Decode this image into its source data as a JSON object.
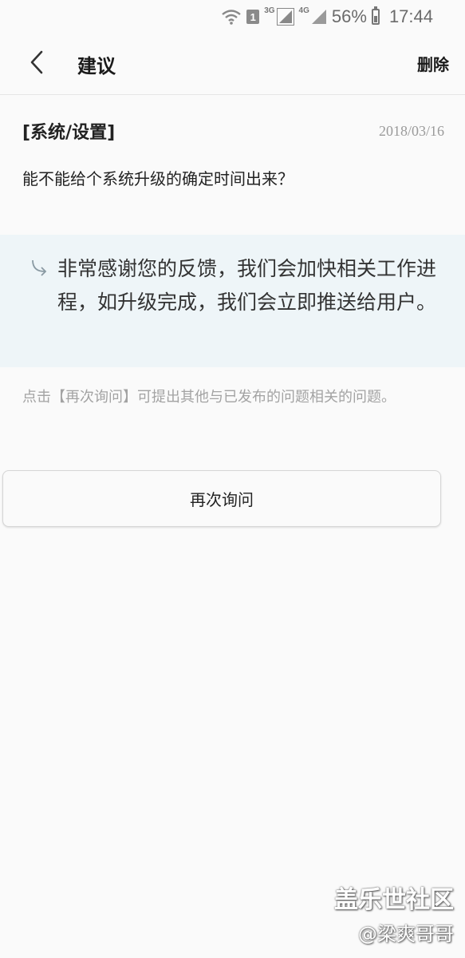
{
  "status_bar": {
    "sim_slot": "1",
    "net_3g": "3G",
    "net_4g": "4G",
    "battery": "56%",
    "battery_level": 0.56,
    "time": "17:44"
  },
  "header": {
    "title": "建议",
    "delete_label": "删除"
  },
  "question": {
    "category": "[系统/设置]",
    "date": "2018/03/16",
    "text": "能不能给个系统升级的确定时间出来？"
  },
  "reply": {
    "text": "非常感谢您的反馈，我们会加快相关工作进程，如升级完成，我们会立即推送给用户。"
  },
  "hint": {
    "text": "点击【再次询问】可提出其他与已发布的问题相关的问题。"
  },
  "ask_again": {
    "label": "再次询问"
  },
  "watermark": {
    "title": "盖乐世社区",
    "author": "@梁爽哥哥"
  }
}
